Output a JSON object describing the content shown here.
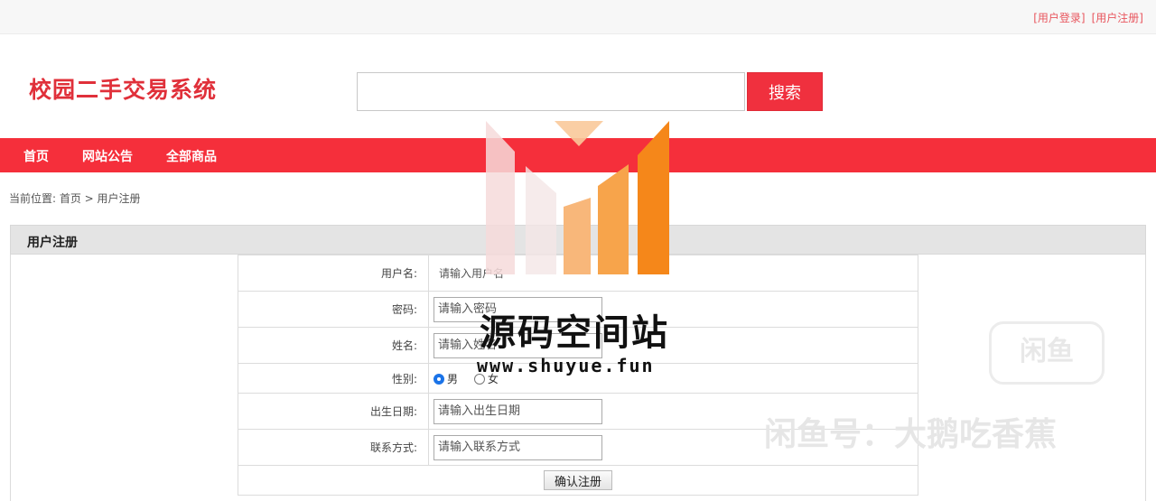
{
  "top_links": {
    "login": "[用户登录]",
    "register": "[用户注册]"
  },
  "site": {
    "logo_text": "校园二手交易系统"
  },
  "search": {
    "placeholder": "",
    "button_label": "搜索"
  },
  "nav": {
    "home": "首页",
    "notice": "网站公告",
    "all_goods": "全部商品"
  },
  "breadcrumb": "当前位置: 首页 >  用户注册",
  "panel": {
    "title": "用户注册"
  },
  "form": {
    "username": {
      "label": "用户名:",
      "value": "请输入用户名"
    },
    "password": {
      "label": "密码:",
      "placeholder": "请输入密码"
    },
    "realname": {
      "label": "姓名:",
      "placeholder": "请输入姓名"
    },
    "gender": {
      "label": "性别:",
      "options": [
        "男",
        "女"
      ],
      "selected": "男"
    },
    "birthday": {
      "label": "出生日期:",
      "placeholder": "请输入出生日期"
    },
    "phone": {
      "label": "联系方式:",
      "placeholder": "请输入联系方式"
    },
    "submit_label": "确认注册"
  },
  "watermark": {
    "title": "源码空间站",
    "url": "www.shuyue.fun",
    "xianyu_logo": "闲鱼",
    "xianyu_tag": "闲鱼号：大鹅吃香蕉"
  },
  "colors": {
    "brand_red": "#f52f3b",
    "logo_red": "#e0303a",
    "link_red": "#e8565e"
  }
}
